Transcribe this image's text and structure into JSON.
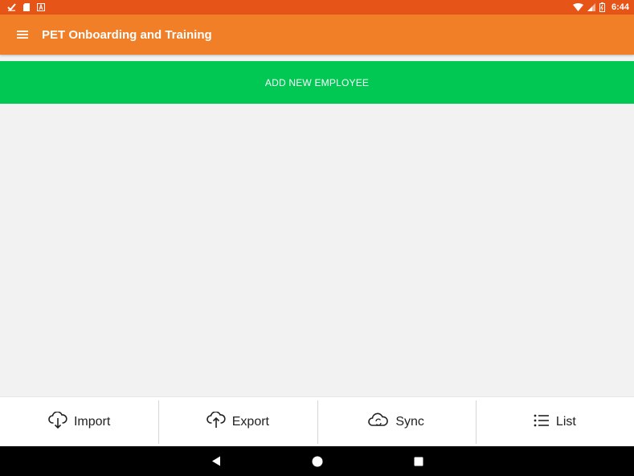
{
  "status_bar": {
    "time": "6:44",
    "background": "#e65517",
    "left_icons": [
      "check-icon",
      "sd-card-icon",
      "a-icon"
    ],
    "right_icons": [
      "wifi-icon",
      "signal-icon",
      "battery-icon"
    ]
  },
  "toolbar": {
    "title": "PET Onboarding and Training",
    "menu_icon": "hamburger-menu-icon",
    "background": "#f07f27"
  },
  "add_employee": {
    "label": "ADD NEW EMPLOYEE",
    "background": "#00c853"
  },
  "bottom_actions": [
    {
      "label": "Import",
      "icon": "cloud-download-icon"
    },
    {
      "label": "Export",
      "icon": "cloud-upload-icon"
    },
    {
      "label": "Sync",
      "icon": "cloud-sync-icon"
    },
    {
      "label": "List",
      "icon": "list-icon"
    }
  ],
  "nav_bar": {
    "buttons": [
      "back-icon",
      "home-icon",
      "recents-icon"
    ]
  }
}
